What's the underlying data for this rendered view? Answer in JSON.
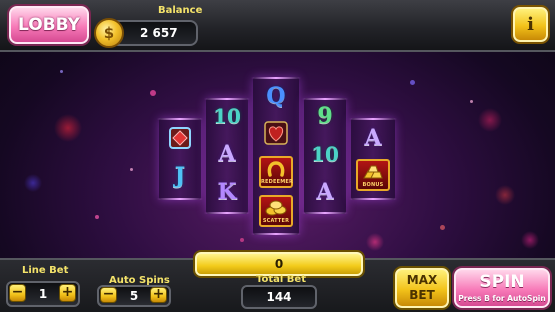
{
  "header": {
    "lobby_label": "LOBBY",
    "balance_label": "Balance",
    "balance_value": "2 657",
    "coin_icon_glyph": "$",
    "info_label": "i"
  },
  "reels": [
    [
      "diamond",
      "J"
    ],
    [
      "10",
      "A",
      "K"
    ],
    [
      "Q",
      "heart",
      "horseshoe",
      "coins"
    ],
    [
      "9",
      "10",
      "A"
    ],
    [
      "A",
      "gold"
    ]
  ],
  "symbol_labels": {
    "horseshoe": "REDEEMER",
    "coins": "SCATTER",
    "gold": "BONUS"
  },
  "progress": {
    "value": "0"
  },
  "footer": {
    "line_bet_label": "Line Bet",
    "line_bet_value": "1",
    "auto_spins_label": "Auto Spins",
    "auto_spins_value": "5",
    "total_bet_label": "Total Bet",
    "total_bet_value": "144",
    "minus_glyph": "−",
    "plus_glyph": "+",
    "max_bet_line1": "MAX",
    "max_bet_line2": "BET",
    "spin_label": "SPIN",
    "spin_hint": "Press B for AutoSpin"
  },
  "colors": {
    "accent_pink": "#f77ab8",
    "accent_yellow": "#f2c21a",
    "label_yellow": "#f4e36a"
  }
}
